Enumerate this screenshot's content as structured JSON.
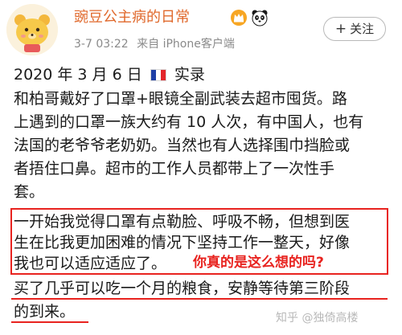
{
  "post": {
    "username": "豌豆公主病的日常",
    "time": "3-7 03:22",
    "source": "来自 iPhone客户端",
    "follow_label": "关注",
    "follow_plus": "+"
  },
  "content": {
    "date_line": "2020 年 3 月 6 日",
    "date_suffix": "实录",
    "para1": [
      "和柏哥戴好了口罩+眼镜全副武装去超市囤货。路",
      "上遇到的口罩一族大约有 10 人次，有中国人，也有",
      "法国的老爷爷老奶奶。当然也有人选择围巾挡脸或",
      "者捂住口鼻。超市的工作人员都带上了一次性手",
      "套。"
    ],
    "para2": [
      "一开始我觉得口罩有点勒脸、呼吸不畅，但想到医",
      "生在比我更加困难的情况下坚持工作一整天，好像",
      "我也可以适应适应了。"
    ],
    "para3": [
      "买了几乎可以吃一个月的粮食，安静等待第三阶段",
      "的到来。"
    ]
  },
  "annotation": {
    "comment": "你真的是这么想的吗?"
  },
  "watermark": {
    "text": "知乎 @独倚高楼"
  },
  "colors": {
    "username": "#e0692c",
    "annotation": "#e8231f",
    "meta": "#8a8a8a"
  },
  "icons": {
    "avatar": "cartoon-bear-avatar",
    "badge1": "crown-badge-icon",
    "badge2": "panda-icon",
    "flag": "france-flag-icon"
  }
}
